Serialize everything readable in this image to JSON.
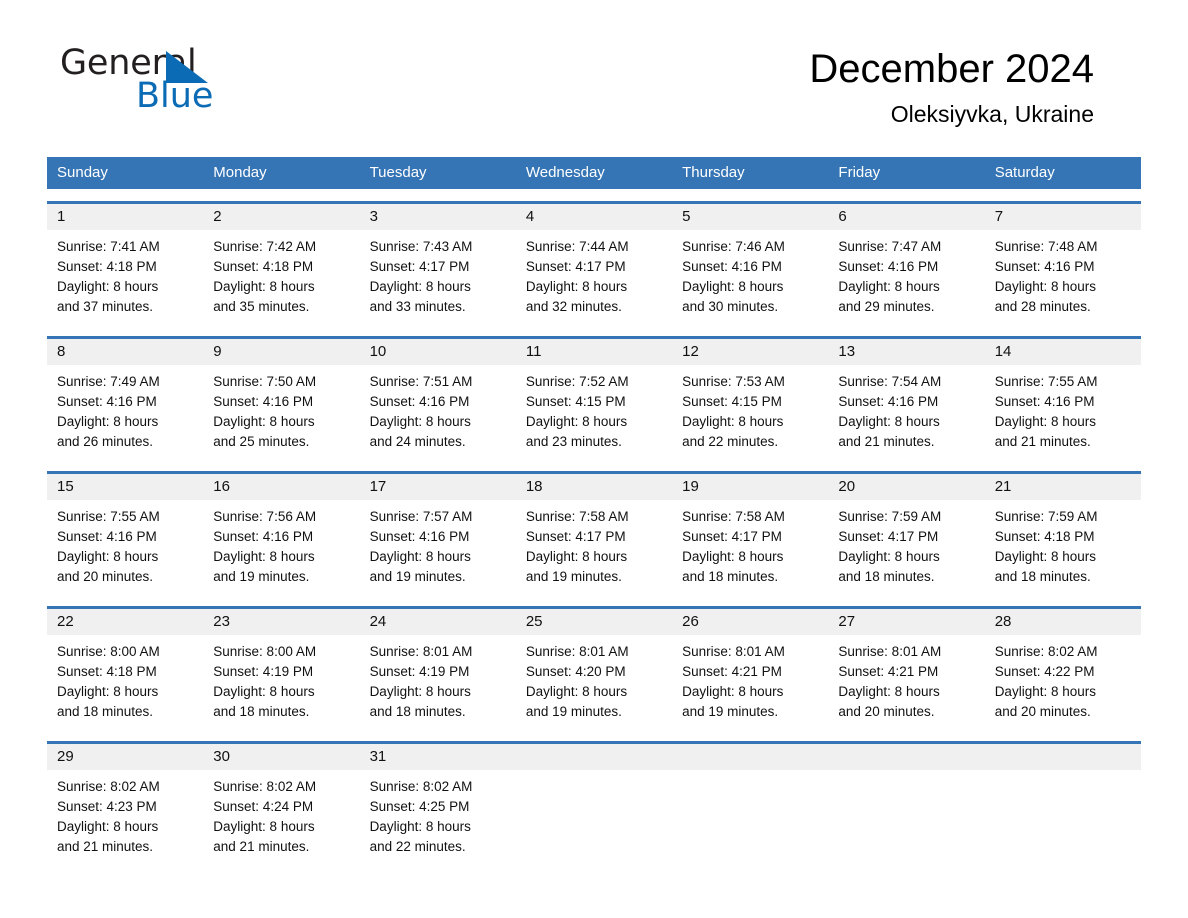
{
  "brand": {
    "name_part1": "General",
    "name_part2": "Blue",
    "accent_color": "#0b6cb5"
  },
  "header": {
    "title": "December 2024",
    "subtitle": "Oleksiyvka, Ukraine",
    "header_bg_color": "#3575b5",
    "day_band_color": "#f0f0f0"
  },
  "weekdays": [
    "Sunday",
    "Monday",
    "Tuesday",
    "Wednesday",
    "Thursday",
    "Friday",
    "Saturday"
  ],
  "weeks": [
    {
      "numbers": [
        "1",
        "2",
        "3",
        "4",
        "5",
        "6",
        "7"
      ],
      "days": [
        {
          "sunrise": "Sunrise: 7:41 AM",
          "sunset": "Sunset: 4:18 PM",
          "daylight1": "Daylight: 8 hours",
          "daylight2": "and 37 minutes."
        },
        {
          "sunrise": "Sunrise: 7:42 AM",
          "sunset": "Sunset: 4:18 PM",
          "daylight1": "Daylight: 8 hours",
          "daylight2": "and 35 minutes."
        },
        {
          "sunrise": "Sunrise: 7:43 AM",
          "sunset": "Sunset: 4:17 PM",
          "daylight1": "Daylight: 8 hours",
          "daylight2": "and 33 minutes."
        },
        {
          "sunrise": "Sunrise: 7:44 AM",
          "sunset": "Sunset: 4:17 PM",
          "daylight1": "Daylight: 8 hours",
          "daylight2": "and 32 minutes."
        },
        {
          "sunrise": "Sunrise: 7:46 AM",
          "sunset": "Sunset: 4:16 PM",
          "daylight1": "Daylight: 8 hours",
          "daylight2": "and 30 minutes."
        },
        {
          "sunrise": "Sunrise: 7:47 AM",
          "sunset": "Sunset: 4:16 PM",
          "daylight1": "Daylight: 8 hours",
          "daylight2": "and 29 minutes."
        },
        {
          "sunrise": "Sunrise: 7:48 AM",
          "sunset": "Sunset: 4:16 PM",
          "daylight1": "Daylight: 8 hours",
          "daylight2": "and 28 minutes."
        }
      ]
    },
    {
      "numbers": [
        "8",
        "9",
        "10",
        "11",
        "12",
        "13",
        "14"
      ],
      "days": [
        {
          "sunrise": "Sunrise: 7:49 AM",
          "sunset": "Sunset: 4:16 PM",
          "daylight1": "Daylight: 8 hours",
          "daylight2": "and 26 minutes."
        },
        {
          "sunrise": "Sunrise: 7:50 AM",
          "sunset": "Sunset: 4:16 PM",
          "daylight1": "Daylight: 8 hours",
          "daylight2": "and 25 minutes."
        },
        {
          "sunrise": "Sunrise: 7:51 AM",
          "sunset": "Sunset: 4:16 PM",
          "daylight1": "Daylight: 8 hours",
          "daylight2": "and 24 minutes."
        },
        {
          "sunrise": "Sunrise: 7:52 AM",
          "sunset": "Sunset: 4:15 PM",
          "daylight1": "Daylight: 8 hours",
          "daylight2": "and 23 minutes."
        },
        {
          "sunrise": "Sunrise: 7:53 AM",
          "sunset": "Sunset: 4:15 PM",
          "daylight1": "Daylight: 8 hours",
          "daylight2": "and 22 minutes."
        },
        {
          "sunrise": "Sunrise: 7:54 AM",
          "sunset": "Sunset: 4:16 PM",
          "daylight1": "Daylight: 8 hours",
          "daylight2": "and 21 minutes."
        },
        {
          "sunrise": "Sunrise: 7:55 AM",
          "sunset": "Sunset: 4:16 PM",
          "daylight1": "Daylight: 8 hours",
          "daylight2": "and 21 minutes."
        }
      ]
    },
    {
      "numbers": [
        "15",
        "16",
        "17",
        "18",
        "19",
        "20",
        "21"
      ],
      "days": [
        {
          "sunrise": "Sunrise: 7:55 AM",
          "sunset": "Sunset: 4:16 PM",
          "daylight1": "Daylight: 8 hours",
          "daylight2": "and 20 minutes."
        },
        {
          "sunrise": "Sunrise: 7:56 AM",
          "sunset": "Sunset: 4:16 PM",
          "daylight1": "Daylight: 8 hours",
          "daylight2": "and 19 minutes."
        },
        {
          "sunrise": "Sunrise: 7:57 AM",
          "sunset": "Sunset: 4:16 PM",
          "daylight1": "Daylight: 8 hours",
          "daylight2": "and 19 minutes."
        },
        {
          "sunrise": "Sunrise: 7:58 AM",
          "sunset": "Sunset: 4:17 PM",
          "daylight1": "Daylight: 8 hours",
          "daylight2": "and 19 minutes."
        },
        {
          "sunrise": "Sunrise: 7:58 AM",
          "sunset": "Sunset: 4:17 PM",
          "daylight1": "Daylight: 8 hours",
          "daylight2": "and 18 minutes."
        },
        {
          "sunrise": "Sunrise: 7:59 AM",
          "sunset": "Sunset: 4:17 PM",
          "daylight1": "Daylight: 8 hours",
          "daylight2": "and 18 minutes."
        },
        {
          "sunrise": "Sunrise: 7:59 AM",
          "sunset": "Sunset: 4:18 PM",
          "daylight1": "Daylight: 8 hours",
          "daylight2": "and 18 minutes."
        }
      ]
    },
    {
      "numbers": [
        "22",
        "23",
        "24",
        "25",
        "26",
        "27",
        "28"
      ],
      "days": [
        {
          "sunrise": "Sunrise: 8:00 AM",
          "sunset": "Sunset: 4:18 PM",
          "daylight1": "Daylight: 8 hours",
          "daylight2": "and 18 minutes."
        },
        {
          "sunrise": "Sunrise: 8:00 AM",
          "sunset": "Sunset: 4:19 PM",
          "daylight1": "Daylight: 8 hours",
          "daylight2": "and 18 minutes."
        },
        {
          "sunrise": "Sunrise: 8:01 AM",
          "sunset": "Sunset: 4:19 PM",
          "daylight1": "Daylight: 8 hours",
          "daylight2": "and 18 minutes."
        },
        {
          "sunrise": "Sunrise: 8:01 AM",
          "sunset": "Sunset: 4:20 PM",
          "daylight1": "Daylight: 8 hours",
          "daylight2": "and 19 minutes."
        },
        {
          "sunrise": "Sunrise: 8:01 AM",
          "sunset": "Sunset: 4:21 PM",
          "daylight1": "Daylight: 8 hours",
          "daylight2": "and 19 minutes."
        },
        {
          "sunrise": "Sunrise: 8:01 AM",
          "sunset": "Sunset: 4:21 PM",
          "daylight1": "Daylight: 8 hours",
          "daylight2": "and 20 minutes."
        },
        {
          "sunrise": "Sunrise: 8:02 AM",
          "sunset": "Sunset: 4:22 PM",
          "daylight1": "Daylight: 8 hours",
          "daylight2": "and 20 minutes."
        }
      ]
    },
    {
      "numbers": [
        "29",
        "30",
        "31",
        "",
        "",
        "",
        ""
      ],
      "days": [
        {
          "sunrise": "Sunrise: 8:02 AM",
          "sunset": "Sunset: 4:23 PM",
          "daylight1": "Daylight: 8 hours",
          "daylight2": "and 21 minutes."
        },
        {
          "sunrise": "Sunrise: 8:02 AM",
          "sunset": "Sunset: 4:24 PM",
          "daylight1": "Daylight: 8 hours",
          "daylight2": "and 21 minutes."
        },
        {
          "sunrise": "Sunrise: 8:02 AM",
          "sunset": "Sunset: 4:25 PM",
          "daylight1": "Daylight: 8 hours",
          "daylight2": "and 22 minutes."
        },
        {
          "sunrise": "",
          "sunset": "",
          "daylight1": "",
          "daylight2": ""
        },
        {
          "sunrise": "",
          "sunset": "",
          "daylight1": "",
          "daylight2": ""
        },
        {
          "sunrise": "",
          "sunset": "",
          "daylight1": "",
          "daylight2": ""
        },
        {
          "sunrise": "",
          "sunset": "",
          "daylight1": "",
          "daylight2": ""
        }
      ]
    }
  ]
}
